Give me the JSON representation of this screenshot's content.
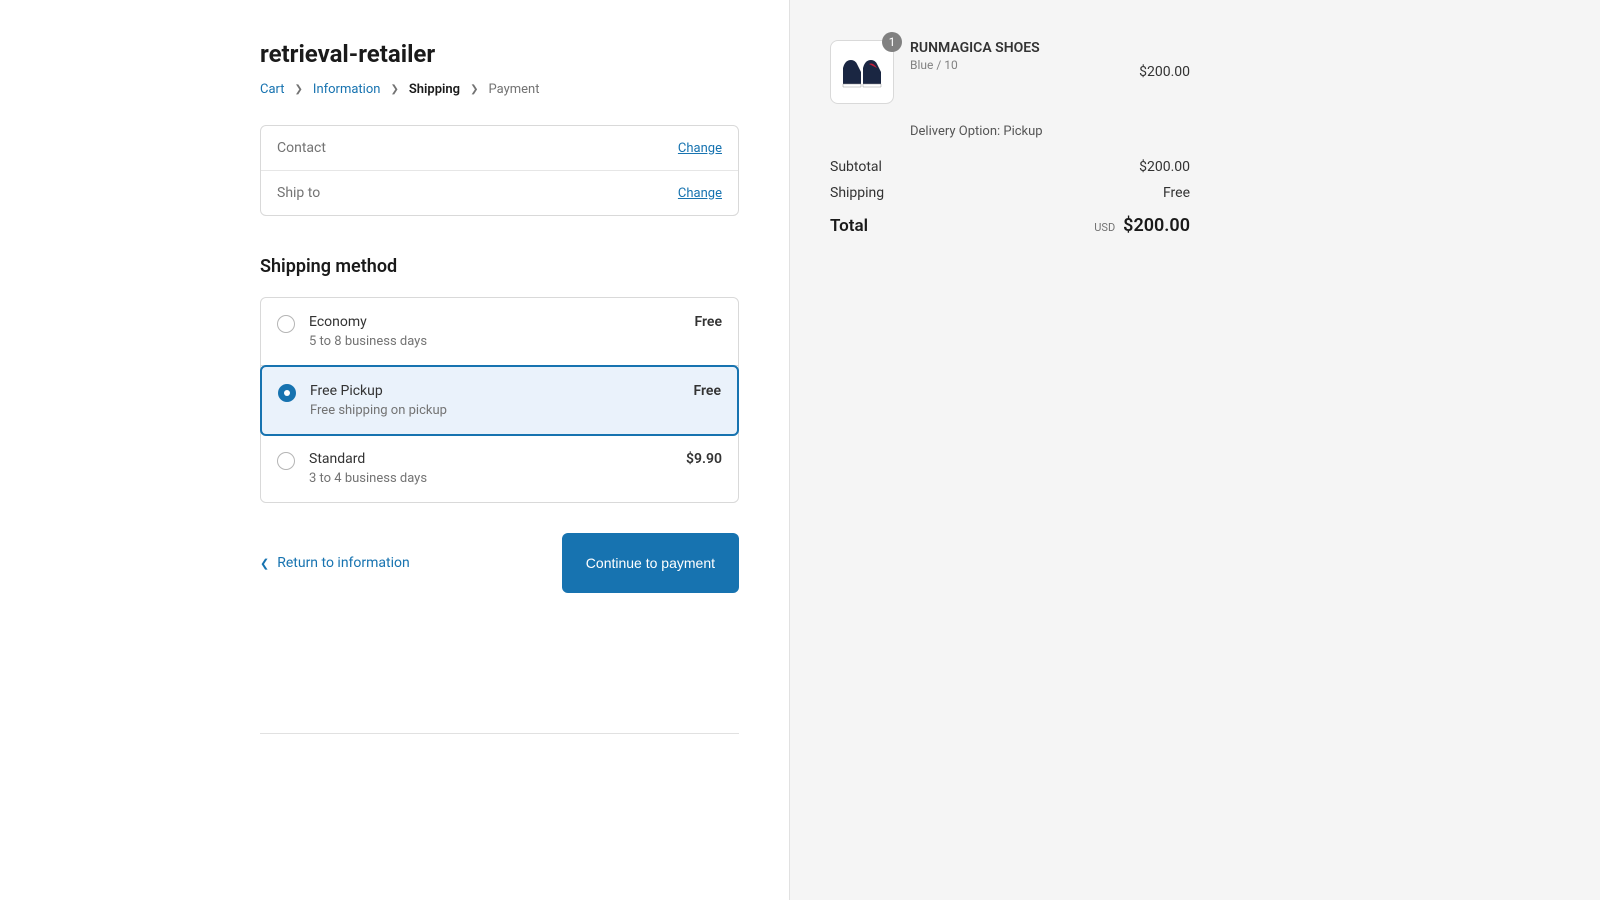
{
  "store": {
    "name": "retrieval-retailer"
  },
  "breadcrumb": {
    "cart": "Cart",
    "information": "Information",
    "shipping": "Shipping",
    "payment": "Payment"
  },
  "review": {
    "contact_label": "Contact",
    "contact_value": "",
    "shipto_label": "Ship to",
    "shipto_value": "",
    "change": "Change"
  },
  "shipping": {
    "heading": "Shipping method",
    "options": [
      {
        "name": "Economy",
        "desc": "5 to 8 business days",
        "price": "Free",
        "selected": false
      },
      {
        "name": "Free Pickup",
        "desc": "Free shipping on pickup",
        "price": "Free",
        "selected": true
      },
      {
        "name": "Standard",
        "desc": "3 to 4 business days",
        "price": "$9.90",
        "selected": false
      }
    ]
  },
  "actions": {
    "back": "Return to information",
    "continue": "Continue to payment"
  },
  "summary": {
    "item": {
      "qty": "1",
      "name": "RUNMAGICA SHOES",
      "variant": "Blue / 10",
      "price": "$200.00",
      "delivery_option": "Delivery Option: Pickup"
    },
    "subtotal_label": "Subtotal",
    "subtotal_value": "$200.00",
    "shipping_label": "Shipping",
    "shipping_value": "Free",
    "total_label": "Total",
    "currency": "USD",
    "total_value": "$200.00"
  }
}
